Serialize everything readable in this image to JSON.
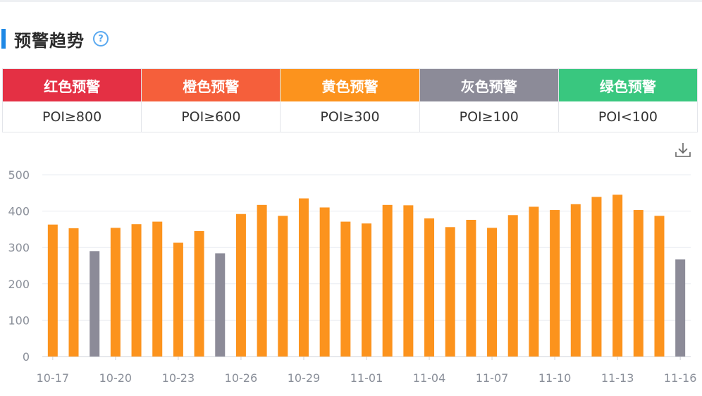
{
  "header": {
    "title": "预警趋势",
    "help_icon": "question-circle-icon"
  },
  "legend": [
    {
      "label": "红色预警",
      "rule": "POI≥800",
      "color": "#e43044"
    },
    {
      "label": "橙色预警",
      "rule": "POI≥600",
      "color": "#f55f3b"
    },
    {
      "label": "黄色预警",
      "rule": "POI≥300",
      "color": "#fc931d"
    },
    {
      "label": "灰色预警",
      "rule": "POI≥100",
      "color": "#8c8b98"
    },
    {
      "label": "绿色预警",
      "rule": "POI<100",
      "color": "#39c77f"
    }
  ],
  "toolbar": {
    "download_icon": "download-icon"
  },
  "chart_data": {
    "type": "bar",
    "categories": [
      "10-17",
      "10-18",
      "10-19",
      "10-20",
      "10-21",
      "10-22",
      "10-23",
      "10-24",
      "10-25",
      "10-26",
      "10-27",
      "10-28",
      "10-29",
      "10-30",
      "10-31",
      "11-01",
      "11-02",
      "11-03",
      "11-04",
      "11-05",
      "11-06",
      "11-07",
      "11-08",
      "11-09",
      "11-10",
      "11-11",
      "11-12",
      "11-13",
      "11-14",
      "11-15",
      "11-16"
    ],
    "x_tick_labels": [
      "10-17",
      "10-20",
      "10-23",
      "10-26",
      "10-29",
      "11-01",
      "11-04",
      "11-07",
      "11-10",
      "11-13",
      "11-16"
    ],
    "values": [
      363,
      353,
      290,
      354,
      364,
      371,
      313,
      345,
      284,
      392,
      417,
      387,
      435,
      410,
      371,
      366,
      417,
      416,
      380,
      356,
      376,
      354,
      389,
      412,
      403,
      419,
      439,
      445,
      403,
      387,
      267
    ],
    "colors": [
      "#fc931d",
      "#fc931d",
      "#8c8b98",
      "#fc931d",
      "#fc931d",
      "#fc931d",
      "#fc931d",
      "#fc931d",
      "#8c8b98",
      "#fc931d",
      "#fc931d",
      "#fc931d",
      "#fc931d",
      "#fc931d",
      "#fc931d",
      "#fc931d",
      "#fc931d",
      "#fc931d",
      "#fc931d",
      "#fc931d",
      "#fc931d",
      "#fc931d",
      "#fc931d",
      "#fc931d",
      "#fc931d",
      "#fc931d",
      "#fc931d",
      "#fc931d",
      "#fc931d",
      "#fc931d",
      "#8c8b98"
    ],
    "yticks": [
      0,
      100,
      200,
      300,
      400,
      500
    ],
    "ylim": [
      0,
      500
    ],
    "grid": true
  }
}
